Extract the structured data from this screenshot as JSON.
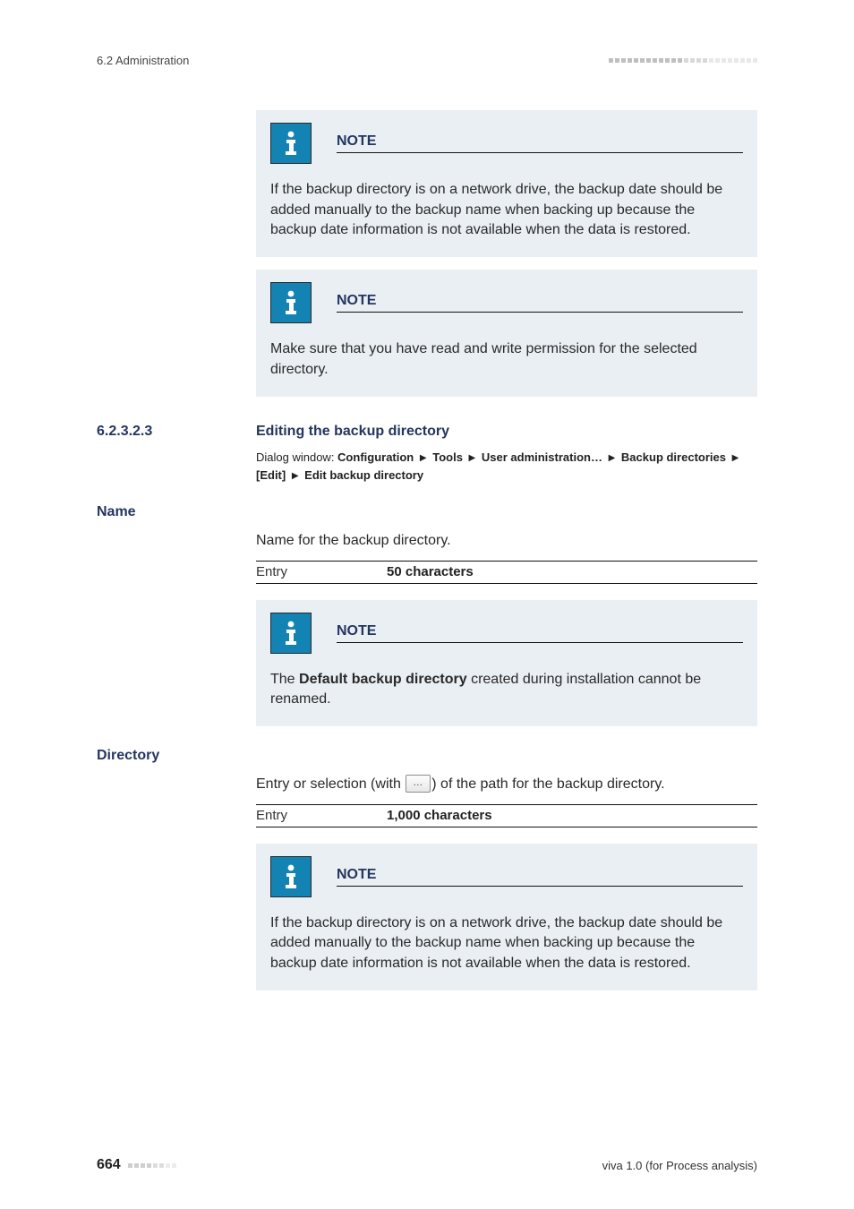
{
  "header": {
    "left": "6.2 Administration"
  },
  "notes": {
    "title": "NOTE",
    "network_drive": "If the backup directory is on a network drive, the backup date should be added manually to the backup name when backing up because the backup date information is not available when the data is restored.",
    "permissions": "Make sure that you have read and write permission for the selected directory.",
    "default_prefix": "The ",
    "default_bold": "Default backup directory",
    "default_suffix": " created during installation cannot be renamed."
  },
  "section": {
    "number": "6.2.3.2.3",
    "title": "Editing the backup directory"
  },
  "dialog": {
    "lead": "Dialog window: ",
    "p1": "Configuration",
    "p2": "Tools",
    "p3": "User administration…",
    "p4": "Backup directories",
    "p5": "[Edit]",
    "p6": "Edit backup directory"
  },
  "fields": {
    "name_label": "Name",
    "name_desc": "Name for the backup directory.",
    "dir_label": "Directory",
    "dir_desc_pre": "Entry or selection (with ",
    "dir_desc_post": ") of the path for the backup directory."
  },
  "entries": {
    "key": "Entry",
    "name_val": "50 characters",
    "dir_val": "1,000 characters"
  },
  "footer": {
    "page": "664",
    "right": "viva 1.0 (for Process analysis)"
  },
  "icons": {
    "info": "info-icon",
    "browse": "…"
  }
}
